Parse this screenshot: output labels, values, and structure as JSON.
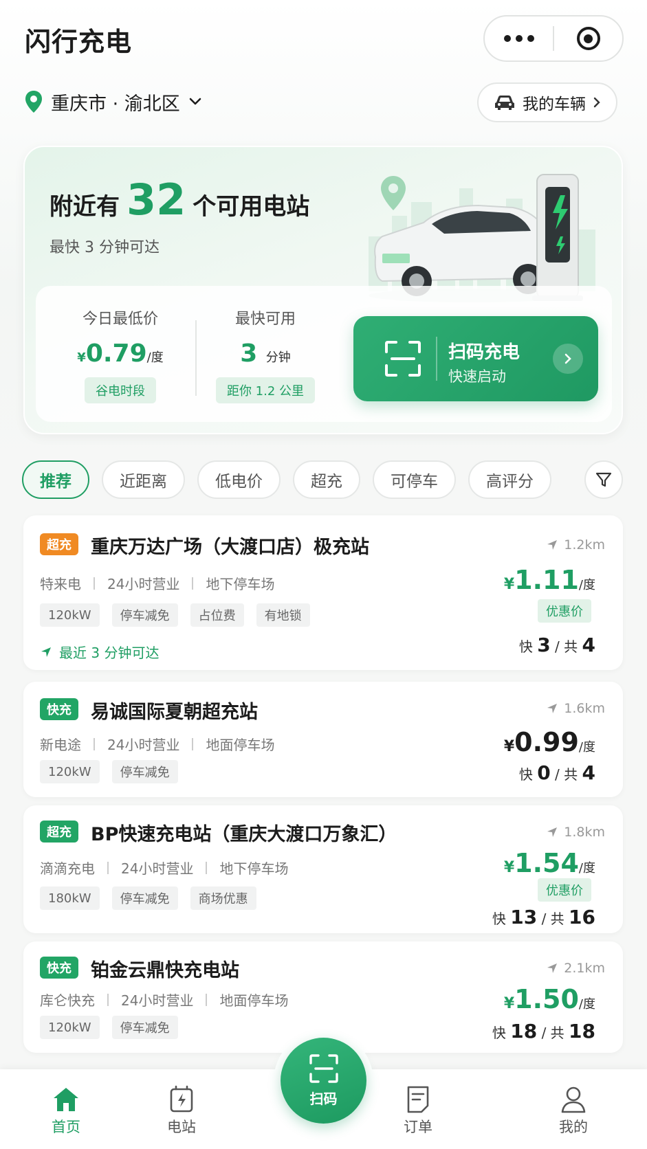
{
  "app": {
    "title": "闪行充电"
  },
  "location": {
    "text": "重庆市 · 渝北区"
  },
  "vehicle": {
    "label": "我的车辆"
  },
  "hero": {
    "prefix": "附近有",
    "count": "32",
    "suffix": "个可用电站",
    "subtitle": "最快 3 分钟可达",
    "lowest_price_label": "今日最低价",
    "lowest_price_currency": "¥",
    "lowest_price_value": "0.79",
    "lowest_price_unit": "/度",
    "lowest_price_tag": "谷电时段",
    "fastest_label": "最快可用",
    "fastest_value": "3",
    "fastest_unit": "分钟",
    "fastest_tag": "距你 1.2 公里",
    "scan_title": "扫码充电",
    "scan_subtitle": "快速启动"
  },
  "filters": [
    "推荐",
    "近距离",
    "低电价",
    "超充",
    "可停车",
    "高评分"
  ],
  "stations": [
    {
      "badge": "超充",
      "name": "重庆万达广场（大渡口店）极充站",
      "operator": "特来电",
      "hours": "24小时营业",
      "parking": "地下停车场",
      "tags": [
        "120kW",
        "停车减免",
        "占位费",
        "有地锁"
      ],
      "eta": "最近 3 分钟可达",
      "distance": "1.2km",
      "currency": "¥",
      "price": "1.11",
      "unit": "/度",
      "promo": "优惠价",
      "fast_label": "快",
      "fast": "3",
      "total_label": "/ 共",
      "total": "4"
    },
    {
      "badge": "快充",
      "name": "易诚国际夏朝超充站",
      "operator": "新电途",
      "hours": "24小时营业",
      "parking": "地面停车场",
      "tags": [
        "120kW",
        "停车减免"
      ],
      "distance": "1.6km",
      "currency": "¥",
      "price": "0.99",
      "unit": "/度",
      "fast_label": "快",
      "fast": "0",
      "total_label": "/ 共",
      "total": "4"
    },
    {
      "badge": "超充",
      "name": "BP快速充电站（重庆大渡口万象汇）",
      "operator": "滴滴充电",
      "hours": "24小时营业",
      "parking": "地下停车场",
      "tags": [
        "180kW",
        "停车减免",
        "商场优惠"
      ],
      "distance": "1.8km",
      "currency": "¥",
      "price": "1.54",
      "unit": "/度",
      "promo": "优惠价",
      "fast_label": "快",
      "fast": "13",
      "total_label": "/ 共",
      "total": "16"
    },
    {
      "badge": "快充",
      "name": "铂金云鼎快充电站",
      "operator": "库仑快充",
      "hours": "24小时营业",
      "parking": "地面停车场",
      "tags": [
        "120kW",
        "停车减免"
      ],
      "distance": "2.1km",
      "currency": "¥",
      "price": "1.50",
      "unit": "/度",
      "fast_label": "快",
      "fast": "18",
      "total_label": "/ 共",
      "total": "18"
    }
  ],
  "nav": {
    "home": "首页",
    "stations": "电站",
    "scan": "扫码",
    "orders": "订单",
    "mine": "我的"
  },
  "colors": {
    "accent": "#1f9e63",
    "super_badge": "#f08a23",
    "fast_badge": "#22a565"
  },
  "icons": [
    "more-dots-icon",
    "target-icon",
    "location-pin-icon",
    "chevron-down-icon",
    "car-icon",
    "chevron-right-icon",
    "scan-frame-icon",
    "filter-icon",
    "navigation-arrow-icon",
    "home-icon",
    "station-icon",
    "order-icon",
    "user-icon"
  ]
}
